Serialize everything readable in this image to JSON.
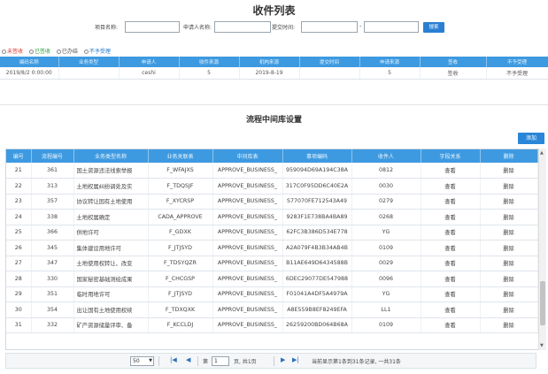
{
  "page": {
    "title": "收件列表"
  },
  "search": {
    "project_label": "项目名称:",
    "applicant_label": "申请人名称:",
    "time_label": "提交时间:",
    "range_dash": "-",
    "button": "搜索"
  },
  "legend": {
    "items": [
      {
        "label": "未签收",
        "color": "#d9342b"
      },
      {
        "label": "已签收",
        "color": "#2e9b3c"
      },
      {
        "label": "已办结",
        "color": "#555555"
      },
      {
        "label": "不予受理",
        "color": "#1f77c9"
      }
    ]
  },
  "top_table": {
    "columns": [
      "编码名称",
      "业务类型",
      "申请人",
      "收件来源",
      "机构来源",
      "提交时间",
      "申请来源",
      "签收",
      "不予受理"
    ],
    "rows": [
      [
        "2019/8/2 0:00:00",
        "",
        "ceshi",
        "5",
        "2019-8-19",
        "",
        "5",
        "签收",
        "不予受理"
      ]
    ]
  },
  "section": {
    "title": "流程中间库设置"
  },
  "add_button": "添加",
  "grid": {
    "columns": [
      "编号",
      "流程编号",
      "业务类型名称",
      "业务关联表",
      "中间库表",
      "事项编码",
      "收件人",
      "字段关系",
      "删除"
    ],
    "rows": [
      [
        "21",
        "361",
        "国土资源违法线索举报",
        "F_WFAJXS",
        "APPROVE_BUSINESS_",
        "959094D69A194C38A",
        "0812",
        "查看",
        "删除"
      ],
      [
        "22",
        "313",
        "土地权属纠纷调处及实",
        "F_TDQSJF",
        "APPROVE_BUSINESS_",
        "317C0F95DD6C40E2A",
        "0030",
        "查看",
        "删除"
      ],
      [
        "23",
        "357",
        "协议转让国有土地使用",
        "F_XYCRSP",
        "APPROVE_BUSINESS_",
        "S77070FE712543A49",
        "0279",
        "查看",
        "删除"
      ],
      [
        "24",
        "338",
        "土地权属确定",
        "CADA_APPROVE",
        "APPROVE_BUSINESS_",
        "9283F1E738BA4BA89",
        "0268",
        "查看",
        "删除"
      ],
      [
        "25",
        "366",
        "供地许可",
        "F_GDXK",
        "APPROVE_BUSINESS_",
        "62FC3B386D534E778",
        "YG",
        "查看",
        "删除"
      ],
      [
        "26",
        "345",
        "集体建设用地许可",
        "F_JTJSYD",
        "APPROVE_BUSINESS_",
        "A2A079F4B3B34AB4B",
        "0109",
        "查看",
        "删除"
      ],
      [
        "27",
        "347",
        "土地使用权转让、改变",
        "F_TDSYQZR",
        "APPROVE_BUSINESS_",
        "B11AE649D6434588B",
        "0029",
        "查看",
        "删除"
      ],
      [
        "28",
        "330",
        "国家秘密基础测绘成果",
        "F_CHCGSP",
        "APPROVE_BUSINESS_",
        "6DEC29077DE547988",
        "0096",
        "查看",
        "删除"
      ],
      [
        "29",
        "351",
        "临时用地许可",
        "F_JTJSYD",
        "APPROVE_BUSINESS_",
        "F01041A4DF5A4979A",
        "YG",
        "查看",
        "删除"
      ],
      [
        "30",
        "354",
        "出让国有土地使用权续",
        "F_TDXQXK",
        "APPROVE_BUSINESS_",
        "A8E559B8EF8249EFA",
        "LL1",
        "查看",
        "删除"
      ],
      [
        "31",
        "332",
        "矿产资源储量评审、备",
        "F_KCCLDJ",
        "APPROVE_BUSINESS_",
        "26259200BD064B68A",
        "0109",
        "查看",
        "删除"
      ]
    ]
  },
  "pager": {
    "page_size": "50",
    "page_prefix": "第",
    "current_page": "1",
    "page_suffix": "页, 共1页",
    "summary": "当前显示第1条到31条记录, 一共31条"
  }
}
